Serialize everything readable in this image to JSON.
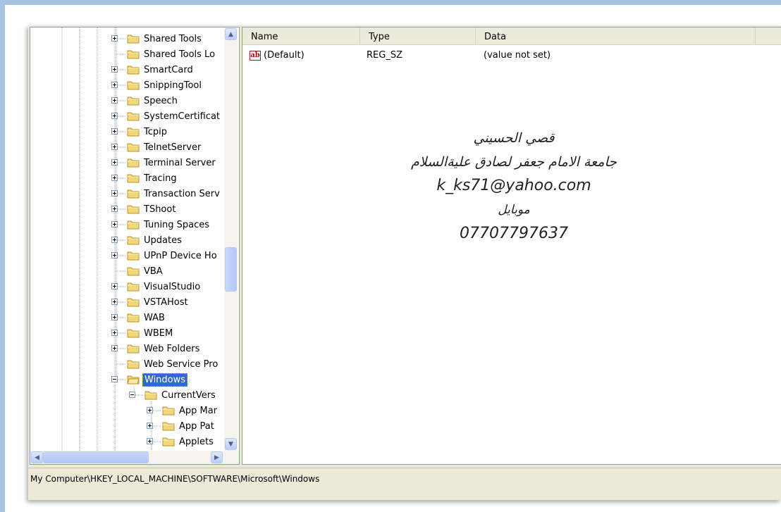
{
  "tree": {
    "items": [
      {
        "label": "Shared Tools",
        "expander": "plus"
      },
      {
        "label": "Shared Tools Lo",
        "expander": "none"
      },
      {
        "label": "SmartCard",
        "expander": "plus"
      },
      {
        "label": "SnippingTool",
        "expander": "plus"
      },
      {
        "label": "Speech",
        "expander": "plus"
      },
      {
        "label": "SystemCertificat",
        "expander": "plus"
      },
      {
        "label": "Tcpip",
        "expander": "plus"
      },
      {
        "label": "TelnetServer",
        "expander": "plus"
      },
      {
        "label": "Terminal Server",
        "expander": "plus"
      },
      {
        "label": "Tracing",
        "expander": "plus"
      },
      {
        "label": "Transaction Serv",
        "expander": "plus"
      },
      {
        "label": "TShoot",
        "expander": "plus"
      },
      {
        "label": "Tuning Spaces",
        "expander": "plus"
      },
      {
        "label": "Updates",
        "expander": "plus"
      },
      {
        "label": "UPnP Device Ho",
        "expander": "plus"
      },
      {
        "label": "VBA",
        "expander": "none"
      },
      {
        "label": "VisualStudio",
        "expander": "plus"
      },
      {
        "label": "VSTAHost",
        "expander": "plus"
      },
      {
        "label": "WAB",
        "expander": "plus"
      },
      {
        "label": "WBEM",
        "expander": "plus"
      },
      {
        "label": "Web Folders",
        "expander": "plus"
      },
      {
        "label": "Web Service Pro",
        "expander": "none"
      },
      {
        "label": "Windows",
        "expander": "minus",
        "selected": true,
        "open": true
      },
      {
        "label": "CurrentVers",
        "expander": "minus",
        "level": 1
      },
      {
        "label": "App Mar",
        "expander": "plus",
        "level": 2
      },
      {
        "label": "App Pat",
        "expander": "plus",
        "level": 2
      },
      {
        "label": "Applets",
        "expander": "plus",
        "level": 2
      }
    ]
  },
  "list": {
    "columns": [
      "Name",
      "Type",
      "Data"
    ],
    "rows": [
      {
        "icon": "string-value-icon",
        "icon_text": "ab",
        "name": "(Default)",
        "type": "REG_SZ",
        "data": "(value not set)"
      }
    ]
  },
  "overlay": {
    "line1": "قصي الحسيني",
    "line2": "جامعة الامام جعفر لصادق عليةالسلام",
    "line3": "k_ks71@yahoo.com",
    "line4": "موبايل",
    "line5": "07707797637"
  },
  "statusbar": {
    "path": "My Computer\\HKEY_LOCAL_MACHINE\\SOFTWARE\\Microsoft\\Windows"
  },
  "colors": {
    "selection": "#316ac5",
    "folder": "#f2d77a",
    "frame": "#a9c3e4"
  }
}
